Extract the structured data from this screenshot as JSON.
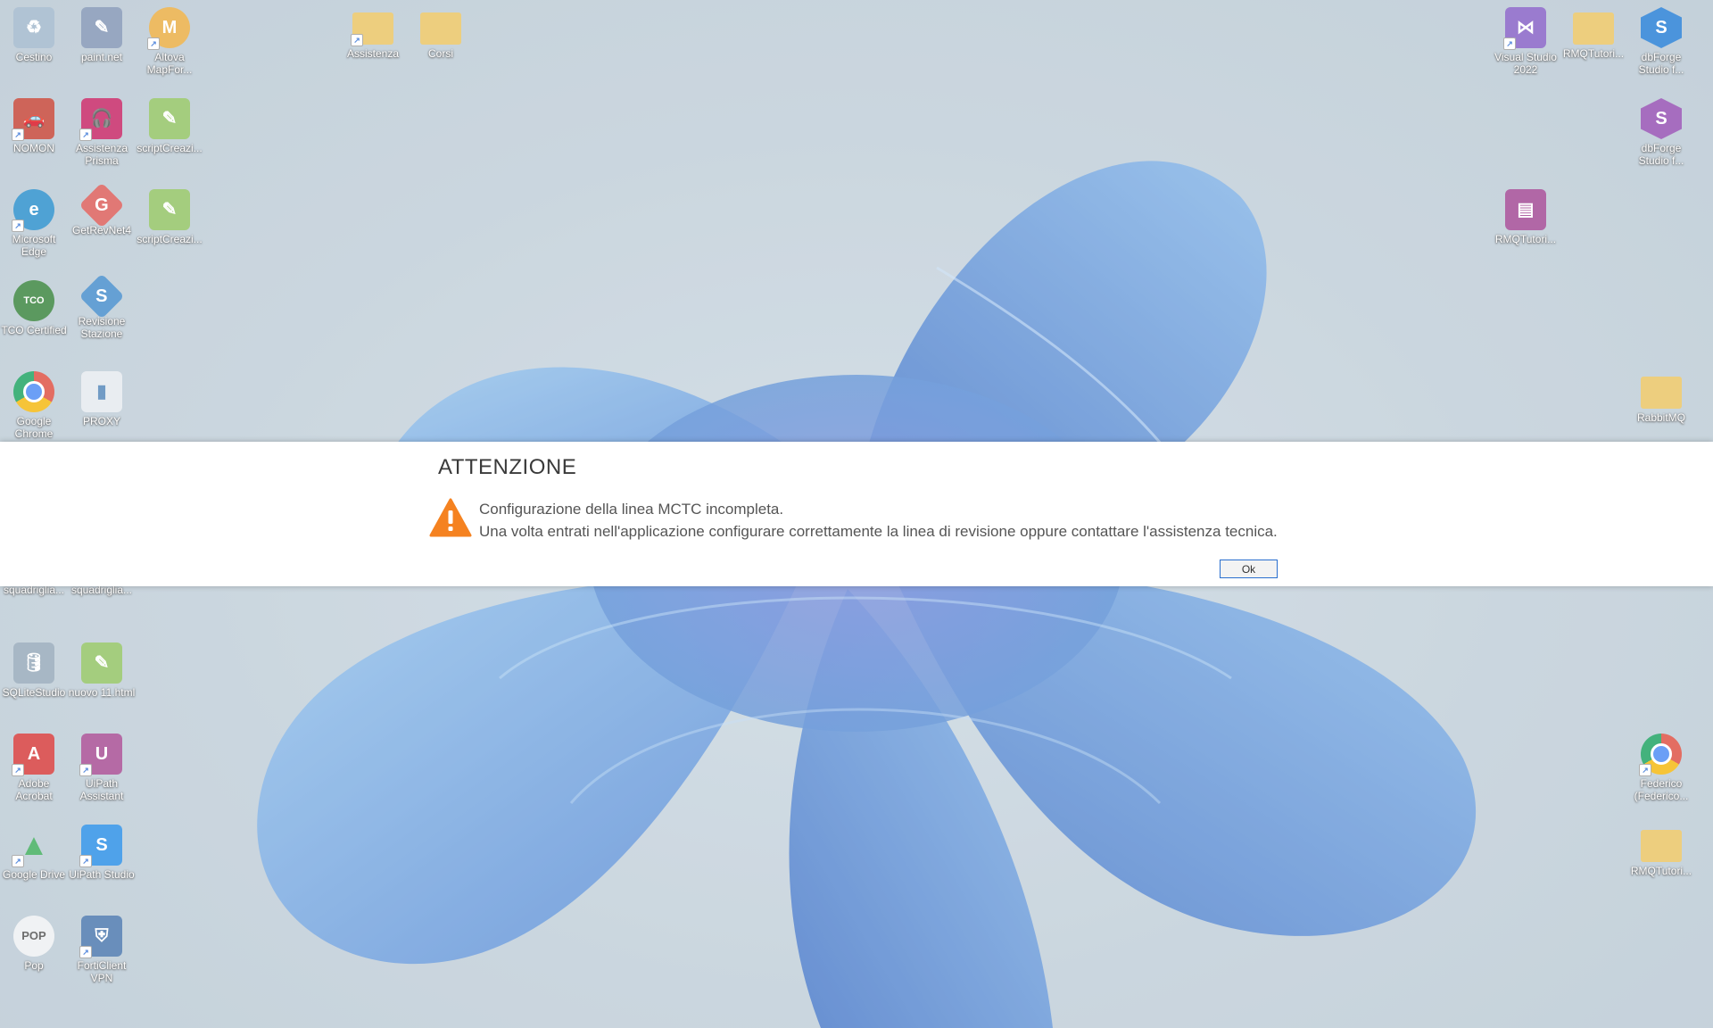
{
  "desktop": {
    "icons": [
      {
        "id": "cestino",
        "label": "Cestino",
        "icon": "recycle-bin-icon",
        "color": "#9ab3c8",
        "glyph": "♻"
      },
      {
        "id": "paintnet",
        "label": "paint.net",
        "icon": "paintnet-icon",
        "color": "#7a8fb0",
        "glyph": "✎"
      },
      {
        "id": "altova",
        "label": "Altova MapFor...",
        "icon": "altova-mapforce-icon",
        "color": "#e8a838",
        "glyph": "M"
      },
      {
        "id": "nomon",
        "label": "NOMON",
        "icon": "nomon-car-icon",
        "color": "#c0392b",
        "glyph": "🚗"
      },
      {
        "id": "assistenza-prisma",
        "label": "Assistenza Prisma",
        "icon": "headset-icon",
        "color": "#c2185b",
        "glyph": "🎧"
      },
      {
        "id": "script-creazi-1",
        "label": "scriptCreazi...",
        "icon": "script-notepad-icon",
        "color": "#8bbf5a",
        "glyph": "✎"
      },
      {
        "id": "edge",
        "label": "Microsoft Edge",
        "icon": "edge-icon",
        "color": "#1e88c8",
        "glyph": "e"
      },
      {
        "id": "getrevnet4",
        "label": "GetRevNet4",
        "icon": "getrevnet-icon",
        "color": "#d9534f",
        "glyph": "G"
      },
      {
        "id": "script-creazi-2",
        "label": "scriptCreazi...",
        "icon": "script-notepad-icon",
        "color": "#8bbf5a",
        "glyph": "✎"
      },
      {
        "id": "tco",
        "label": "TCO Certified",
        "icon": "tco-certified-icon",
        "color": "#2e7d32",
        "glyph": "TCO"
      },
      {
        "id": "revisione-stazione",
        "label": "Revisione Stazione",
        "icon": "revisione-stazione-icon",
        "color": "#3a86c8",
        "glyph": "S"
      },
      {
        "id": "chrome",
        "label": "Google Chrome",
        "icon": "chrome-icon",
        "color": "#db4437",
        "glyph": "●"
      },
      {
        "id": "proxy",
        "label": "PROXY",
        "icon": "proxy-window-icon",
        "color": "#4a7fb5",
        "glyph": "▮"
      },
      {
        "id": "uscita-1",
        "label": "Uscita di squadriglia...",
        "icon": "document-icon",
        "color": "#dfe6ec",
        "glyph": ""
      },
      {
        "id": "uscita-2",
        "label": "Uscita di squadriglia...",
        "icon": "document-icon",
        "color": "#dfe6ec",
        "glyph": ""
      },
      {
        "id": "sqlitestudio",
        "label": "SQLiteStudio",
        "icon": "database-icon",
        "color": "#8fa3b5",
        "glyph": "🛢"
      },
      {
        "id": "nuovo-html",
        "label": "nuovo 11.html",
        "icon": "script-notepad-icon",
        "color": "#8bbf5a",
        "glyph": "✎"
      },
      {
        "id": "acrobat",
        "label": "Adobe Acrobat",
        "icon": "acrobat-icon",
        "color": "#d32f2f",
        "glyph": "A"
      },
      {
        "id": "uipath-assistant",
        "label": "UiPath Assistant",
        "icon": "uipath-assistant-icon",
        "color": "#a0408c",
        "glyph": "U"
      },
      {
        "id": "google-drive",
        "label": "Google Drive",
        "icon": "google-drive-icon",
        "color": "#34a853",
        "glyph": "▲"
      },
      {
        "id": "uipath-studio",
        "label": "UiPath Studio",
        "icon": "uipath-studio-icon",
        "color": "#1e88e5",
        "glyph": "S"
      },
      {
        "id": "pop",
        "label": "Pop",
        "icon": "pop-icon",
        "color": "#607d8b",
        "glyph": "POP"
      },
      {
        "id": "forticlient",
        "label": "FortiClient VPN",
        "icon": "forticlient-shield-icon",
        "color": "#3f6fa8",
        "glyph": "⛨"
      },
      {
        "id": "assistenza-folder",
        "label": "Assistenza",
        "icon": "folder-icon",
        "color": "#e8c15a",
        "glyph": ""
      },
      {
        "id": "corsi-folder",
        "label": "Corsi",
        "icon": "folder-icon",
        "color": "#e8c15a",
        "glyph": ""
      },
      {
        "id": "visual-studio",
        "label": "Visual Studio 2022",
        "icon": "visual-studio-icon",
        "color": "#7e57c2",
        "glyph": "⋈"
      },
      {
        "id": "rmq-folder-1",
        "label": "RMQTutori...",
        "icon": "folder-icon",
        "color": "#e8c15a",
        "glyph": ""
      },
      {
        "id": "dbforge-1",
        "label": "dbForge Studio f...",
        "icon": "dbforge-icon",
        "color": "#1976d2",
        "glyph": "S"
      },
      {
        "id": "dbforge-2",
        "label": "dbForge Studio f...",
        "icon": "dbforge-icon",
        "color": "#8e44ad",
        "glyph": "S"
      },
      {
        "id": "rmq-archive",
        "label": "RMQTutori...",
        "icon": "winrar-archive-icon",
        "color": "#9c3d8e",
        "glyph": "▤"
      },
      {
        "id": "rabbitmq-folder",
        "label": "RabbitMQ",
        "icon": "folder-icon",
        "color": "#e8c15a",
        "glyph": ""
      },
      {
        "id": "federico",
        "label": "Federico (Federico...",
        "icon": "chrome-profile-icon",
        "color": "#db4437",
        "glyph": "●"
      },
      {
        "id": "rmq-folder-2",
        "label": "RMQTutori...",
        "icon": "folder-icon",
        "color": "#e8c15a",
        "glyph": ""
      }
    ]
  },
  "dialog": {
    "title": "ATTENZIONE",
    "icon": "warning-icon",
    "icon_color": "#f58220",
    "message_line_1": "Configurazione della linea MCTC incompleta.",
    "message_line_2": "Una volta entrati nell'applicazione configurare correttamente la linea di revisione oppure contattare l'assistenza tecnica.",
    "ok_label": "Ok"
  },
  "colors": {
    "dialog_background": "#ffffff",
    "ok_button_border": "#2a6fcf",
    "wallpaper_bloom": "#5b8fd6"
  }
}
